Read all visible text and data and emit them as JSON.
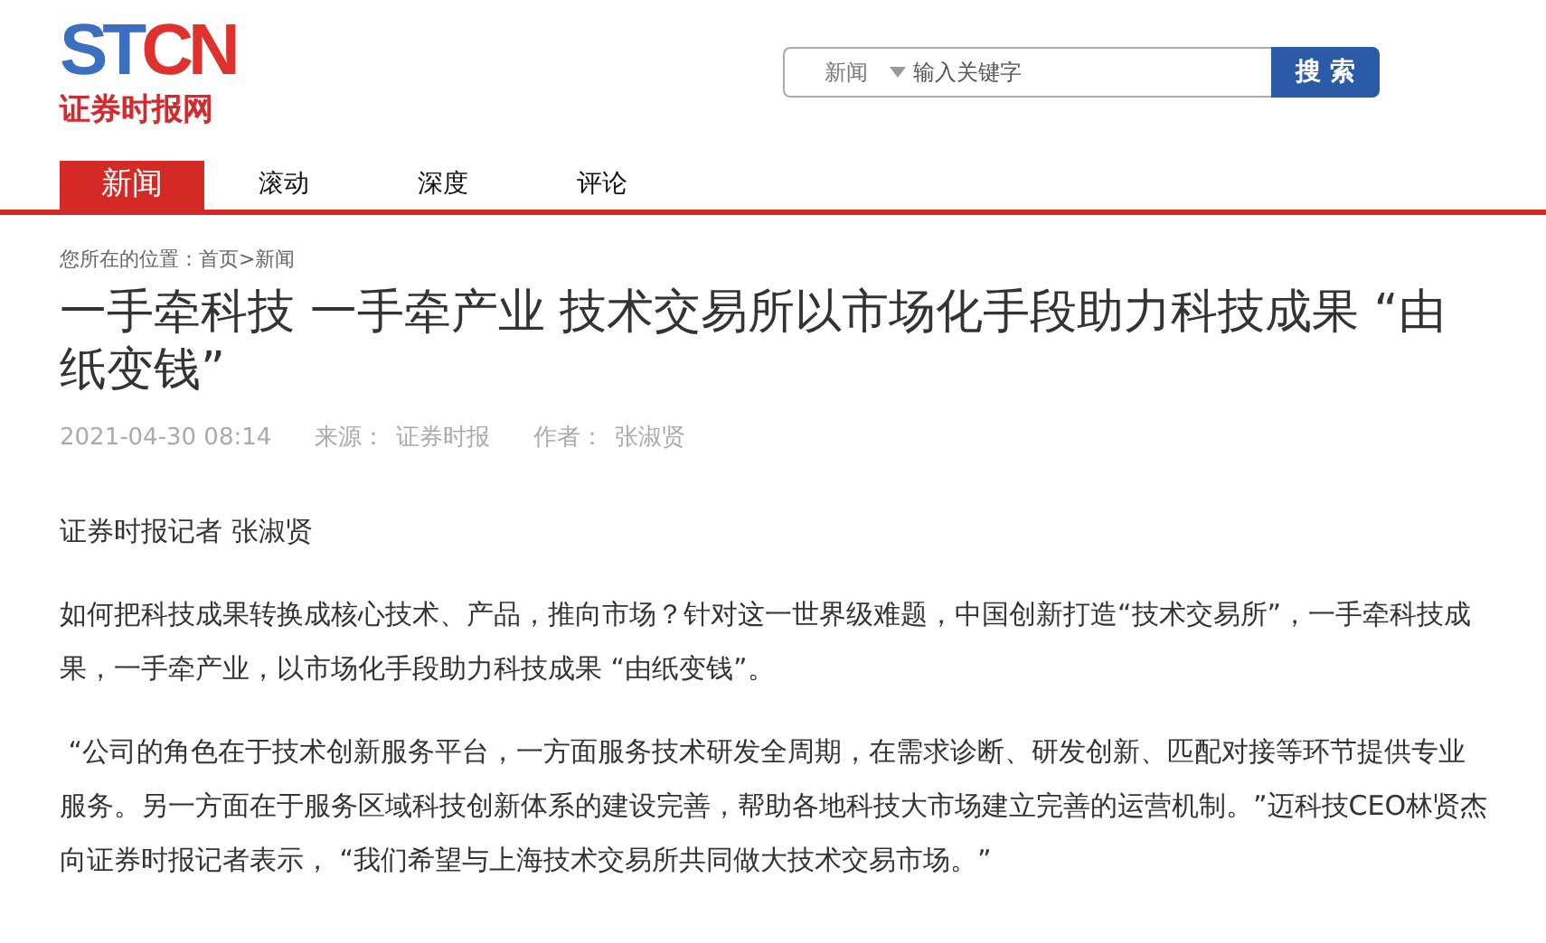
{
  "logo": {
    "letters_1": "ST",
    "letters_2": "CN",
    "name": "证券时报网"
  },
  "search": {
    "scope": "新闻",
    "placeholder": "输入关键字",
    "button": "搜 索"
  },
  "nav": [
    {
      "label": "新闻",
      "selected": true
    },
    {
      "label": "滚动",
      "selected": false
    },
    {
      "label": "深度",
      "selected": false
    },
    {
      "label": "评论",
      "selected": false
    }
  ],
  "breadcrumb": "您所在的位置：首页>新闻",
  "article": {
    "title": "一手牵科技 一手牵产业 技术交易所以市场化手段助力科技成果 “由纸变钱”",
    "date": "2021-04-30 08:14",
    "source_label": "来源：",
    "source": "证券时报",
    "author_label": "作者：",
    "author": "张淑贤",
    "paragraphs": [
      "证券时报记者 张淑贤",
      "如何把科技成果转换成核心技术、产品，推向市场？针对这一世界级难题，中国创新打造“技术交易所”，一手牵科技成果，一手牵产业，以市场化手段助力科技成果 “由纸变钱”。",
      " “公司的角色在于技术创新服务平台，一方面服务技术研发全周期，在需求诊断、研发创新、匹配对接等环节提供专业服务。另一方面在于服务区域科技创新体系的建设完善，帮助各地科技大市场建立完善的运营机制。”迈科技CEO林贤杰向证券时报记者表示， “我们希望与上海技术交易所共同做大技术交易市场。”"
    ]
  }
}
